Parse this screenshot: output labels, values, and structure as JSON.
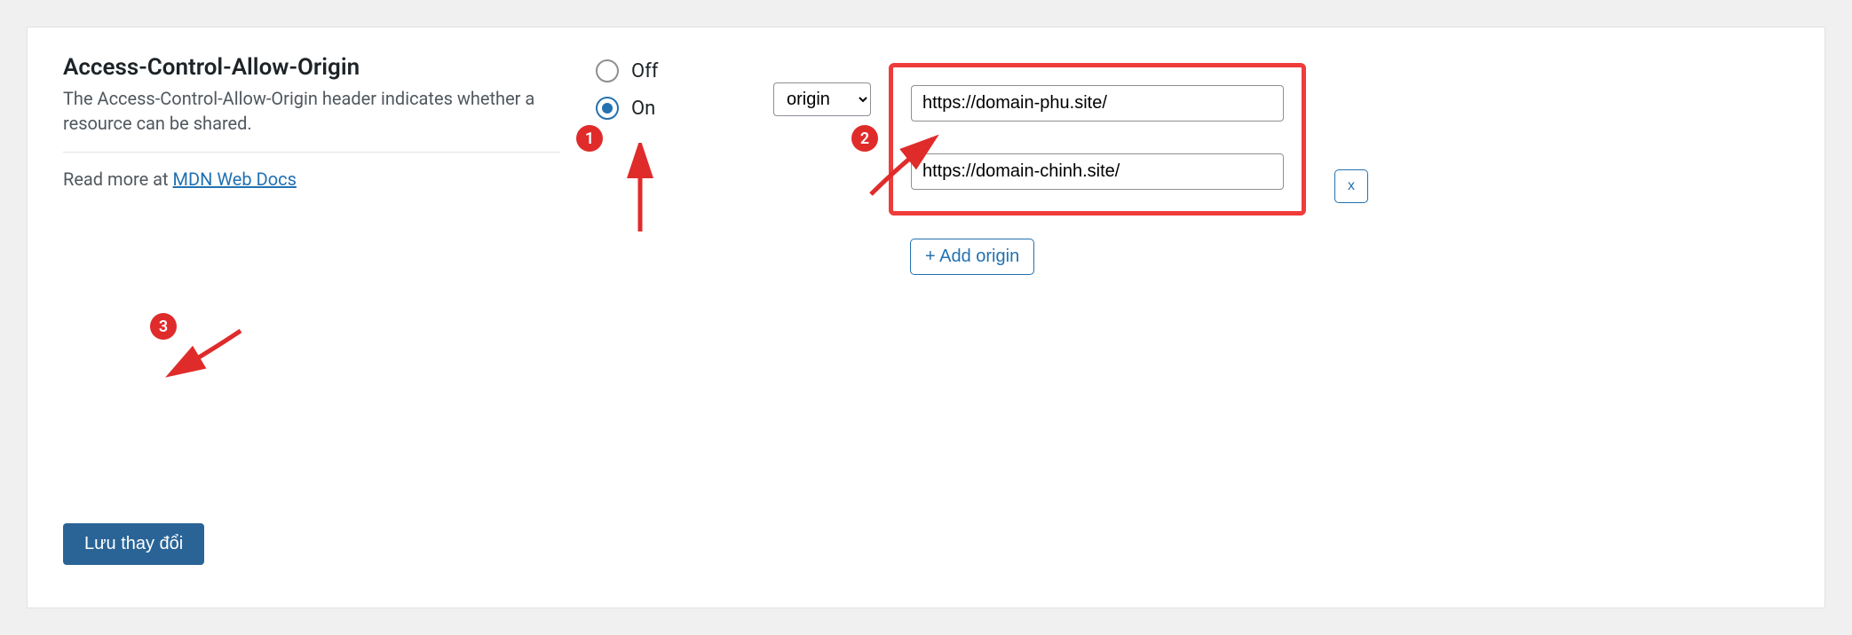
{
  "setting": {
    "title": "Access-Control-Allow-Origin",
    "description": "The Access-Control-Allow-Origin header indicates whether a resource can be shared.",
    "readmore_prefix": "Read more at ",
    "readmore_link_text": "MDN Web Docs"
  },
  "radio": {
    "off_label": "Off",
    "on_label": "On",
    "selected": "on"
  },
  "select": {
    "value_label": "origin"
  },
  "origins": {
    "items": [
      {
        "value": "https://domain-phu.site/"
      },
      {
        "value": "https://domain-chinh.site/"
      }
    ],
    "remove_label": "x",
    "add_label": "+ Add origin"
  },
  "save_label": "Lưu thay đổi",
  "annotations": {
    "b1": "1",
    "b2": "2",
    "b3": "3"
  },
  "colors": {
    "primary": "#2271b1",
    "save_bg": "#2a6496",
    "highlight": "#f03b3b",
    "badge": "#e02b2b"
  }
}
